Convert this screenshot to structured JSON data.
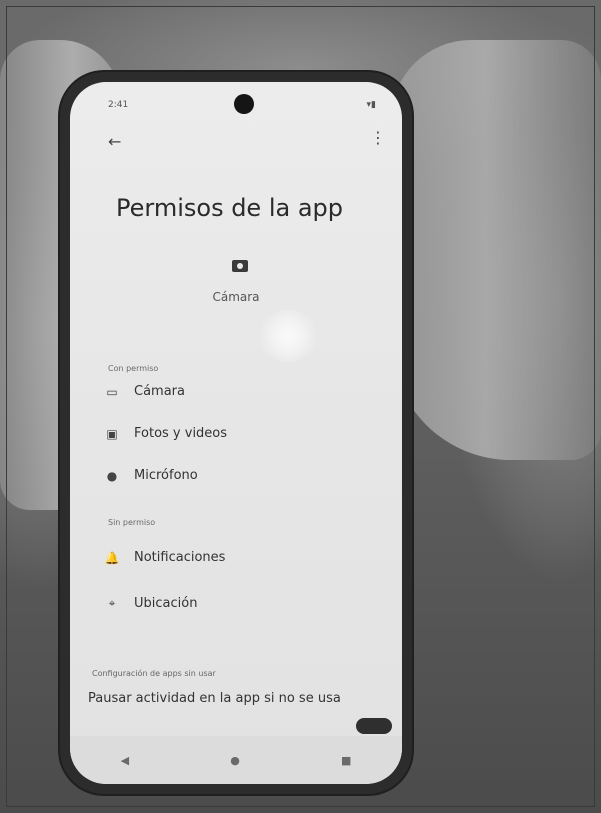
{
  "status_bar": {
    "time": "2:41",
    "right": "▾▮"
  },
  "header": {
    "back_glyph": "←",
    "menu_glyph": "⋮",
    "title": "Permisos de la app"
  },
  "app": {
    "name": "Cámara",
    "icon": "camera-app-icon"
  },
  "sections": {
    "allowed": {
      "label": "Con permiso",
      "items": [
        {
          "label": "Cámara",
          "icon": "video-camera-icon",
          "glyph": "▭"
        },
        {
          "label": "Fotos y videos",
          "icon": "photos-icon",
          "glyph": "▣"
        },
        {
          "label": "Micrófono",
          "icon": "microphone-icon",
          "glyph": "●"
        }
      ]
    },
    "denied": {
      "label": "Sin permiso",
      "items": [
        {
          "label": "Notificaciones",
          "icon": "bell-icon",
          "glyph": "🔔"
        },
        {
          "label": "Ubicación",
          "icon": "location-pin-icon",
          "glyph": "⌖"
        }
      ]
    }
  },
  "footer": {
    "label": "Configuración de apps sin usar",
    "text": "Pausar actividad en la app si no se usa"
  },
  "navbar": {
    "back": "◀",
    "home": "●",
    "recents": "■"
  }
}
